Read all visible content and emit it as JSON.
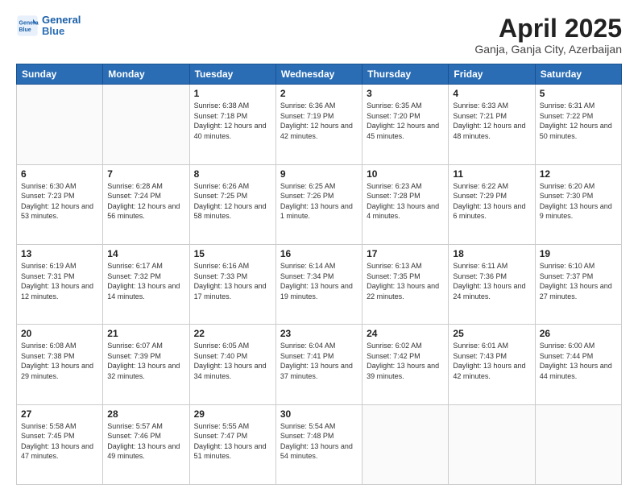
{
  "header": {
    "logo_line1": "General",
    "logo_line2": "Blue",
    "month_title": "April 2025",
    "location": "Ganja, Ganja City, Azerbaijan"
  },
  "weekdays": [
    "Sunday",
    "Monday",
    "Tuesday",
    "Wednesday",
    "Thursday",
    "Friday",
    "Saturday"
  ],
  "weeks": [
    [
      {
        "day": "",
        "sunrise": "",
        "sunset": "",
        "daylight": ""
      },
      {
        "day": "",
        "sunrise": "",
        "sunset": "",
        "daylight": ""
      },
      {
        "day": "1",
        "sunrise": "Sunrise: 6:38 AM",
        "sunset": "Sunset: 7:18 PM",
        "daylight": "Daylight: 12 hours and 40 minutes."
      },
      {
        "day": "2",
        "sunrise": "Sunrise: 6:36 AM",
        "sunset": "Sunset: 7:19 PM",
        "daylight": "Daylight: 12 hours and 42 minutes."
      },
      {
        "day": "3",
        "sunrise": "Sunrise: 6:35 AM",
        "sunset": "Sunset: 7:20 PM",
        "daylight": "Daylight: 12 hours and 45 minutes."
      },
      {
        "day": "4",
        "sunrise": "Sunrise: 6:33 AM",
        "sunset": "Sunset: 7:21 PM",
        "daylight": "Daylight: 12 hours and 48 minutes."
      },
      {
        "day": "5",
        "sunrise": "Sunrise: 6:31 AM",
        "sunset": "Sunset: 7:22 PM",
        "daylight": "Daylight: 12 hours and 50 minutes."
      }
    ],
    [
      {
        "day": "6",
        "sunrise": "Sunrise: 6:30 AM",
        "sunset": "Sunset: 7:23 PM",
        "daylight": "Daylight: 12 hours and 53 minutes."
      },
      {
        "day": "7",
        "sunrise": "Sunrise: 6:28 AM",
        "sunset": "Sunset: 7:24 PM",
        "daylight": "Daylight: 12 hours and 56 minutes."
      },
      {
        "day": "8",
        "sunrise": "Sunrise: 6:26 AM",
        "sunset": "Sunset: 7:25 PM",
        "daylight": "Daylight: 12 hours and 58 minutes."
      },
      {
        "day": "9",
        "sunrise": "Sunrise: 6:25 AM",
        "sunset": "Sunset: 7:26 PM",
        "daylight": "Daylight: 13 hours and 1 minute."
      },
      {
        "day": "10",
        "sunrise": "Sunrise: 6:23 AM",
        "sunset": "Sunset: 7:28 PM",
        "daylight": "Daylight: 13 hours and 4 minutes."
      },
      {
        "day": "11",
        "sunrise": "Sunrise: 6:22 AM",
        "sunset": "Sunset: 7:29 PM",
        "daylight": "Daylight: 13 hours and 6 minutes."
      },
      {
        "day": "12",
        "sunrise": "Sunrise: 6:20 AM",
        "sunset": "Sunset: 7:30 PM",
        "daylight": "Daylight: 13 hours and 9 minutes."
      }
    ],
    [
      {
        "day": "13",
        "sunrise": "Sunrise: 6:19 AM",
        "sunset": "Sunset: 7:31 PM",
        "daylight": "Daylight: 13 hours and 12 minutes."
      },
      {
        "day": "14",
        "sunrise": "Sunrise: 6:17 AM",
        "sunset": "Sunset: 7:32 PM",
        "daylight": "Daylight: 13 hours and 14 minutes."
      },
      {
        "day": "15",
        "sunrise": "Sunrise: 6:16 AM",
        "sunset": "Sunset: 7:33 PM",
        "daylight": "Daylight: 13 hours and 17 minutes."
      },
      {
        "day": "16",
        "sunrise": "Sunrise: 6:14 AM",
        "sunset": "Sunset: 7:34 PM",
        "daylight": "Daylight: 13 hours and 19 minutes."
      },
      {
        "day": "17",
        "sunrise": "Sunrise: 6:13 AM",
        "sunset": "Sunset: 7:35 PM",
        "daylight": "Daylight: 13 hours and 22 minutes."
      },
      {
        "day": "18",
        "sunrise": "Sunrise: 6:11 AM",
        "sunset": "Sunset: 7:36 PM",
        "daylight": "Daylight: 13 hours and 24 minutes."
      },
      {
        "day": "19",
        "sunrise": "Sunrise: 6:10 AM",
        "sunset": "Sunset: 7:37 PM",
        "daylight": "Daylight: 13 hours and 27 minutes."
      }
    ],
    [
      {
        "day": "20",
        "sunrise": "Sunrise: 6:08 AM",
        "sunset": "Sunset: 7:38 PM",
        "daylight": "Daylight: 13 hours and 29 minutes."
      },
      {
        "day": "21",
        "sunrise": "Sunrise: 6:07 AM",
        "sunset": "Sunset: 7:39 PM",
        "daylight": "Daylight: 13 hours and 32 minutes."
      },
      {
        "day": "22",
        "sunrise": "Sunrise: 6:05 AM",
        "sunset": "Sunset: 7:40 PM",
        "daylight": "Daylight: 13 hours and 34 minutes."
      },
      {
        "day": "23",
        "sunrise": "Sunrise: 6:04 AM",
        "sunset": "Sunset: 7:41 PM",
        "daylight": "Daylight: 13 hours and 37 minutes."
      },
      {
        "day": "24",
        "sunrise": "Sunrise: 6:02 AM",
        "sunset": "Sunset: 7:42 PM",
        "daylight": "Daylight: 13 hours and 39 minutes."
      },
      {
        "day": "25",
        "sunrise": "Sunrise: 6:01 AM",
        "sunset": "Sunset: 7:43 PM",
        "daylight": "Daylight: 13 hours and 42 minutes."
      },
      {
        "day": "26",
        "sunrise": "Sunrise: 6:00 AM",
        "sunset": "Sunset: 7:44 PM",
        "daylight": "Daylight: 13 hours and 44 minutes."
      }
    ],
    [
      {
        "day": "27",
        "sunrise": "Sunrise: 5:58 AM",
        "sunset": "Sunset: 7:45 PM",
        "daylight": "Daylight: 13 hours and 47 minutes."
      },
      {
        "day": "28",
        "sunrise": "Sunrise: 5:57 AM",
        "sunset": "Sunset: 7:46 PM",
        "daylight": "Daylight: 13 hours and 49 minutes."
      },
      {
        "day": "29",
        "sunrise": "Sunrise: 5:55 AM",
        "sunset": "Sunset: 7:47 PM",
        "daylight": "Daylight: 13 hours and 51 minutes."
      },
      {
        "day": "30",
        "sunrise": "Sunrise: 5:54 AM",
        "sunset": "Sunset: 7:48 PM",
        "daylight": "Daylight: 13 hours and 54 minutes."
      },
      {
        "day": "",
        "sunrise": "",
        "sunset": "",
        "daylight": ""
      },
      {
        "day": "",
        "sunrise": "",
        "sunset": "",
        "daylight": ""
      },
      {
        "day": "",
        "sunrise": "",
        "sunset": "",
        "daylight": ""
      }
    ]
  ]
}
